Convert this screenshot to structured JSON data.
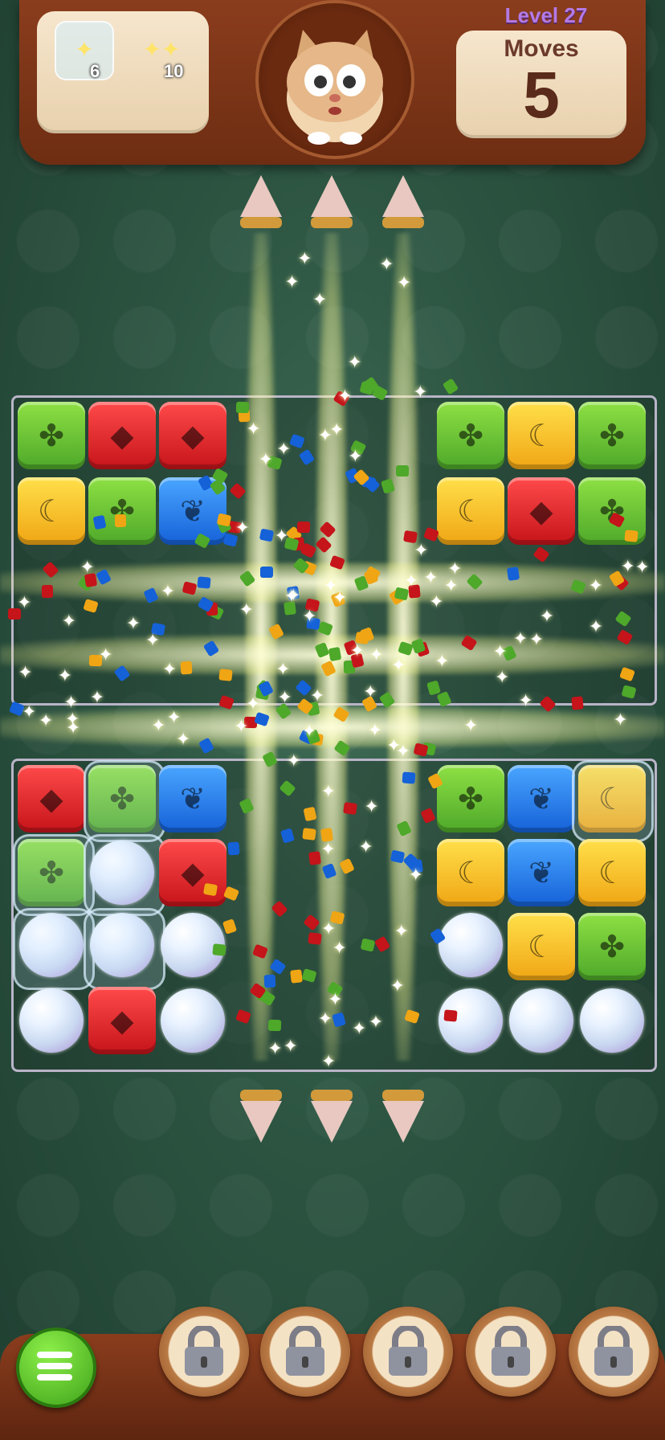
{
  "hud": {
    "level_label": "Level 27",
    "moves_label": "Moves",
    "moves_value": "5",
    "goals": [
      {
        "icon": "star-bubble-icon",
        "count": "6"
      },
      {
        "icon": "star-bubble-icon",
        "count": "10"
      }
    ]
  },
  "boosters": [
    {
      "icon": "lock-icon",
      "state": "locked"
    },
    {
      "icon": "lock-icon",
      "state": "locked"
    },
    {
      "icon": "lock-icon",
      "state": "locked"
    },
    {
      "icon": "lock-icon",
      "state": "locked"
    },
    {
      "icon": "lock-icon",
      "state": "locked"
    }
  ],
  "menu": {
    "icon": "menu-list-icon"
  },
  "colors": {
    "green": "#4ea82a",
    "red": "#c5141a",
    "blue": "#1561d8",
    "yellow": "#f0a514",
    "wood": "#7a3315",
    "level_purple": "#b37ae6"
  }
}
